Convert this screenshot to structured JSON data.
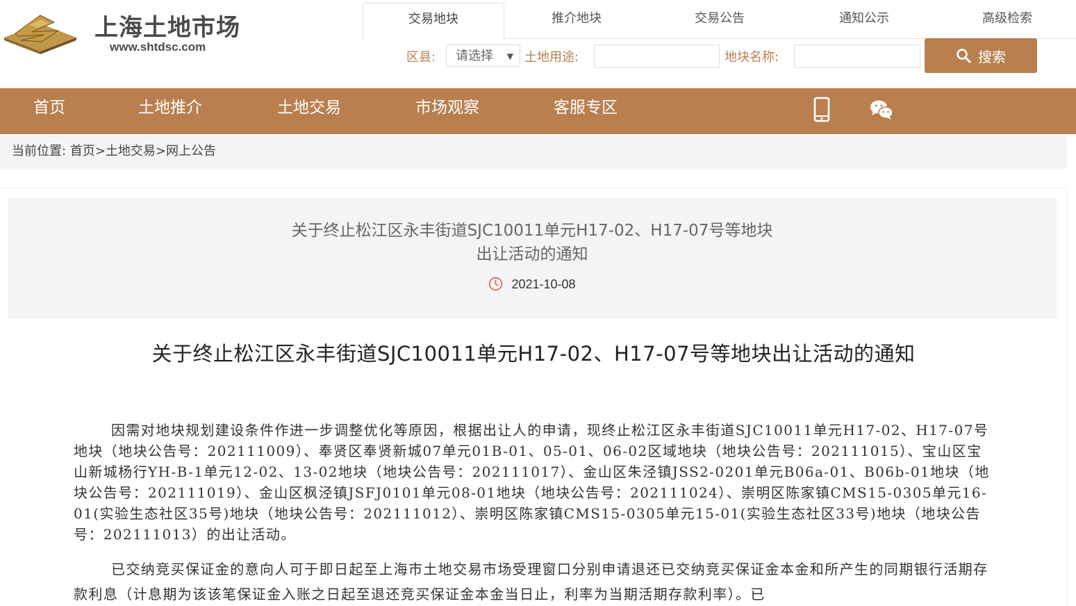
{
  "brand": {
    "name": "上海土地市场",
    "url": "www.shtdsc.com",
    "mark_colors": {
      "gold": "#c0984d",
      "dark": "#8a6a2a"
    }
  },
  "search": {
    "tabs": [
      "交易地块",
      "推介地块",
      "交易公告",
      "通知公示",
      "高级检索"
    ],
    "active_tab": "交易地块",
    "district_label": "区县:",
    "district_value": "请选择",
    "land_use_label": "土地用途:",
    "land_use_value": "",
    "parcel_name_label": "地块名称:",
    "parcel_name_value": "",
    "button_label": "搜索"
  },
  "nav": {
    "items": [
      "首页",
      "土地推介",
      "土地交易",
      "市场观察",
      "客服专区"
    ],
    "icons": [
      "mobile-phone-icon",
      "wechat-icon"
    ],
    "color": "#b97f4e"
  },
  "breadcrumb": {
    "label": "当前位置:",
    "home": "首页",
    "sep1": ">",
    "level2": "土地交易",
    "sep2": ">",
    "current": "网上公告"
  },
  "article": {
    "header_title_line1": "关于终止松江区永丰街道SJC10011单元H17-02、H17-07号等地块",
    "header_title_line2": "出让活动的通知",
    "date": "2021-10-08",
    "title": "关于终止松江区永丰街道SJC10011单元H17-02、H17-07号等地块出让活动的通知",
    "paragraph1": "因需对地块规划建设条件作进一步调整优化等原因，根据出让人的申请，现终止松江区永丰街道SJC10011单元H17-02、H17-07号地块（地块公告号：202111009）、奉贤区奉贤新城07单元01B-01、05-01、06-02区域地块（地块公告号：202111015）、宝山区宝山新城杨行YH-B-1单元12-02、13-02地块（地块公告号：202111017）、金山区朱泾镇JSS2-0201单元B06a-01、B06b-01地块（地块公告号：202111019）、金山区枫泾镇JSFJ0101单元08-01地块（地块公告号：202111024）、崇明区陈家镇CMS15-0305单元16-01(实验生态社区35号)地块（地块公告号：202111012）、崇明区陈家镇CMS15-0305单元15-01(实验生态社区33号)地块（地块公告号：202111013）的出让活动。",
    "paragraph2": "已交纳竞买保证金的意向人可于即日起至上海市土地交易市场受理窗口分别申请退还已交纳竞买保证金本金和所产生的同期银行活期存款利息（计息期为该该笔保证金入账之日起至退还竞买保证金本金当日止，利率为当期活期存款利率）。已"
  }
}
